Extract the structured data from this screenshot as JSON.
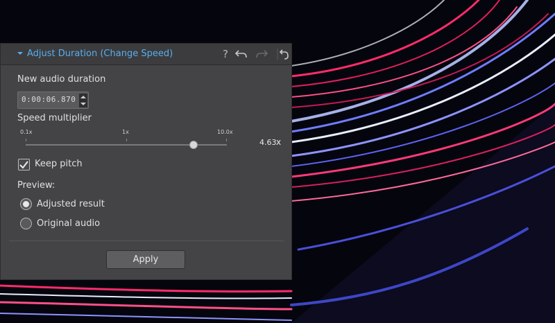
{
  "panel": {
    "title": "Adjust Duration (Change Speed)",
    "accent_color": "#58aef0",
    "toolbar_icons": [
      "chevron-down-icon",
      "help-icon",
      "undo-icon",
      "redo-icon",
      "reset-icon"
    ],
    "help_label": "?"
  },
  "duration": {
    "label": "New audio duration",
    "value": "0:00:06.870"
  },
  "speed": {
    "label": "Speed multiplier",
    "ticks": [
      "0.1x",
      "1x",
      "10.0x"
    ],
    "value": "4.63",
    "unit": "x"
  },
  "keep_pitch": {
    "label": "Keep pitch",
    "checked": true
  },
  "preview": {
    "label": "Preview:",
    "options": [
      {
        "label": "Adjusted result",
        "selected": true
      },
      {
        "label": "Original audio",
        "selected": false
      }
    ]
  },
  "apply_label": "Apply"
}
